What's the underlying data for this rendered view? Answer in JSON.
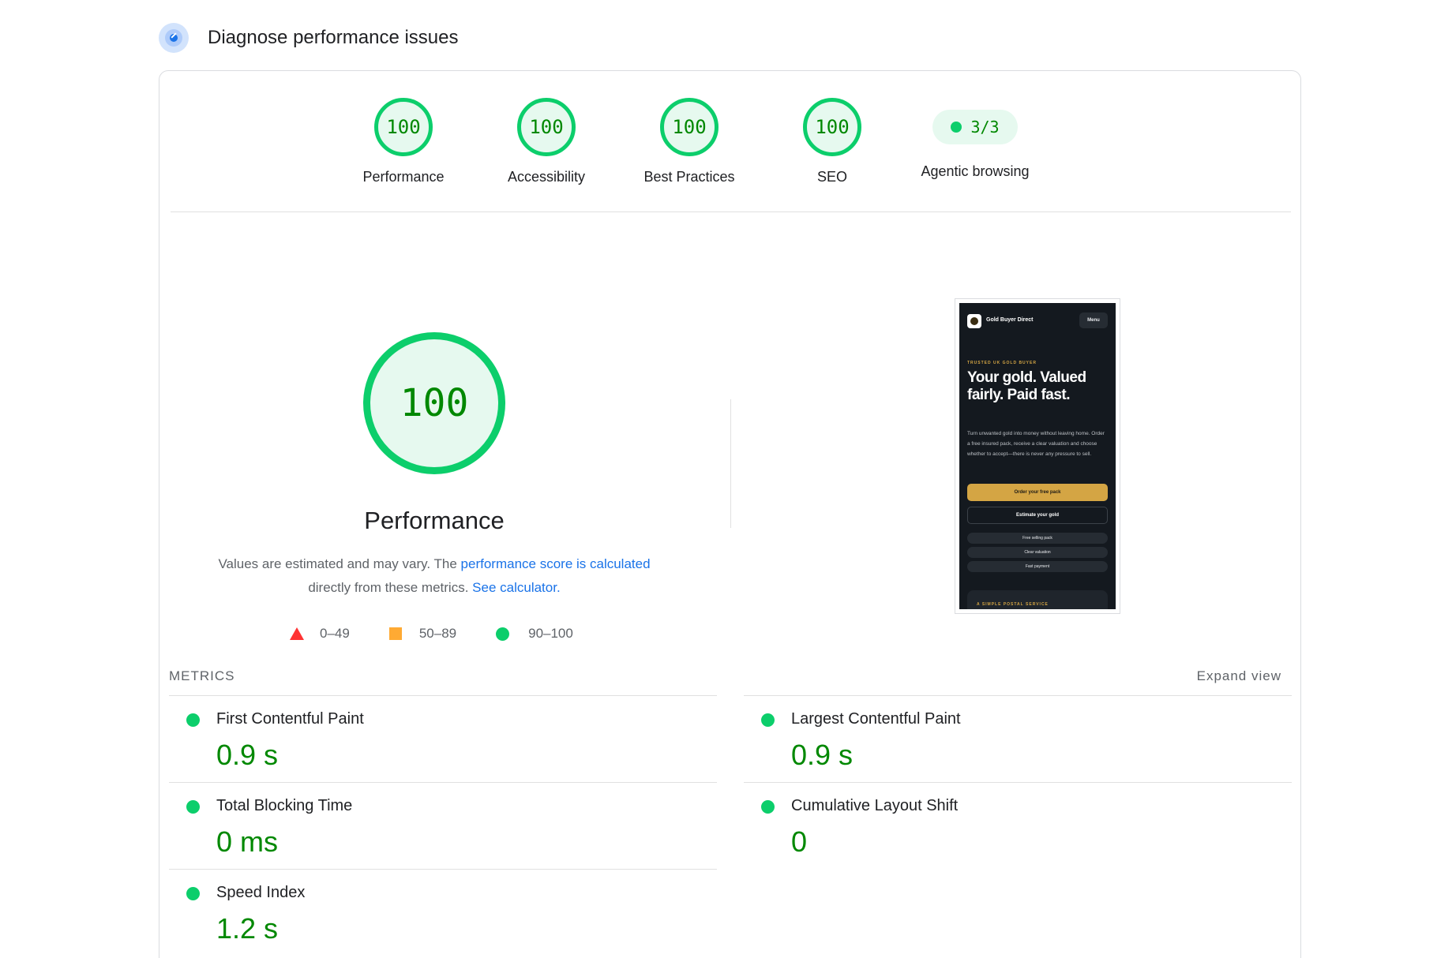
{
  "header": {
    "title": "Diagnose performance issues"
  },
  "gauges": [
    {
      "value": "100",
      "label": "Performance"
    },
    {
      "value": "100",
      "label": "Accessibility"
    },
    {
      "value": "100",
      "label": "Best Practices"
    },
    {
      "value": "100",
      "label": "SEO"
    }
  ],
  "agentic": {
    "value": "3/3",
    "label": "Agentic browsing"
  },
  "performance": {
    "score": "100",
    "title": "Performance",
    "desc_prefix": "Values are estimated and may vary. The ",
    "desc_link": "performance score is calculated",
    "desc_middle": " directly from these metrics. ",
    "calc_link": "See calculator."
  },
  "legend": {
    "fail": "0–49",
    "average": "50–89",
    "pass": "90–100"
  },
  "screenshot": {
    "brand": "Gold Buyer Direct",
    "menu": "Menu",
    "eyebrow": "TRUSTED UK GOLD BUYER",
    "heading": "Your gold. Valued fairly. Paid fast.",
    "body": "Turn unwanted gold into money without leaving home. Order a free insured pack, receive a clear valuation and choose whether to accept—there is never any pressure to sell.",
    "primary_button": "Order your free pack",
    "secondary_button": "Estimate your gold",
    "chips": [
      "Free selling pack",
      "Clear valuation",
      "Fast payment"
    ],
    "section": "A SIMPLE POSTAL SERVICE"
  },
  "metrics": {
    "label": "METRICS",
    "expand": "Expand view",
    "items": [
      {
        "title": "First Contentful Paint",
        "value": "0.9 s"
      },
      {
        "title": "Largest Contentful Paint",
        "value": "0.9 s"
      },
      {
        "title": "Total Blocking Time",
        "value": "0 ms"
      },
      {
        "title": "Cumulative Layout Shift",
        "value": "0"
      },
      {
        "title": "Speed Index",
        "value": "1.2 s"
      }
    ]
  },
  "colors": {
    "pass": "#0cce6b",
    "pass_text": "#008800",
    "average": "#ffaa33",
    "fail": "#ff3333",
    "link": "#1a73e8"
  }
}
